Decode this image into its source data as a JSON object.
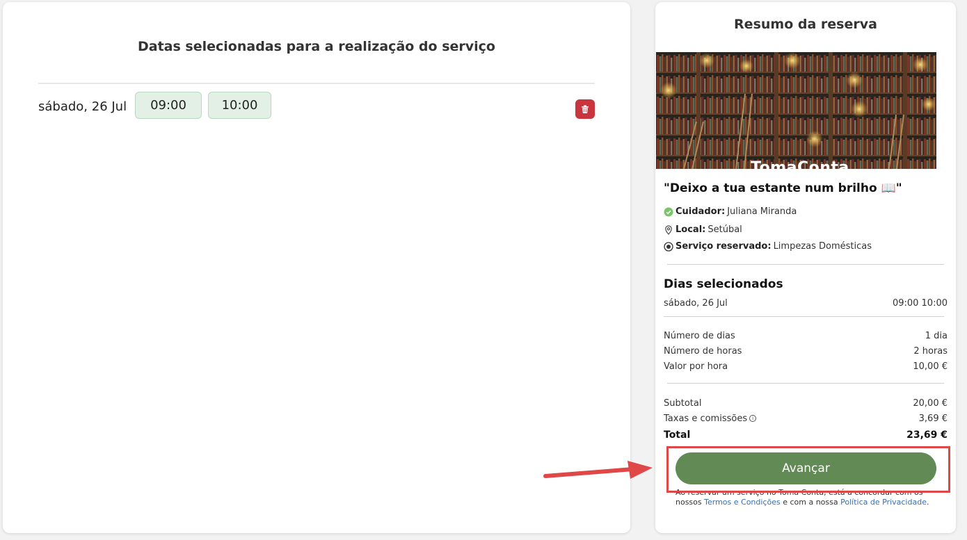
{
  "left": {
    "title": "Datas selecionadas para a realização do serviço",
    "date_label": "sábado, 26 Jul",
    "start_time": "09:00",
    "end_time": "10:00"
  },
  "summary": {
    "title": "Resumo da reserva",
    "banner_brand": "TomaConta",
    "service_title": "\"Deixo a tua estante num brilho 📖\"",
    "caregiver_label": "Cuidador:",
    "caregiver_value": "Juliana Miranda",
    "location_label": "Local:",
    "location_value": "Setúbal",
    "service_label": "Serviço reservado:",
    "service_value": "Limpezas Domésticas",
    "days_heading": "Dias selecionados",
    "day_label": "sábado, 26 Jul",
    "day_times": "09:00 10:00",
    "num_days_label": "Número de dias",
    "num_days_value": "1 dia",
    "num_hours_label": "Número de horas",
    "num_hours_value": "2 horas",
    "rate_label": "Valor por hora",
    "rate_value": "10,00 €",
    "subtotal_label": "Subtotal",
    "subtotal_value": "20,00 €",
    "fees_label": "Taxas e comissões",
    "fees_value": "3,69 €",
    "total_label": "Total",
    "total_value": "23,69 €",
    "advance_button": "Avançar",
    "legal_prefix": "Ao reservar um serviço no Toma Conta, está a concordar com os nossos",
    "terms_link": "Termos e Condições",
    "legal_middle": "e com a nossa",
    "privacy_link": "Política de Privacidade",
    "legal_suffix": "."
  },
  "colors": {
    "accent_green": "#628a55",
    "chip_bg": "#e2f0e6",
    "delete_red": "#c9353f",
    "highlight_red": "#e04848",
    "link_blue": "#3a6fb0",
    "check_green": "#7cc46a"
  },
  "icons": {
    "delete": "trash-icon",
    "caregiver": "check-circle-icon",
    "location": "map-pin-icon",
    "service": "radio-dot-icon",
    "fees_info": "info-icon",
    "annotation": "arrow-right-icon"
  }
}
